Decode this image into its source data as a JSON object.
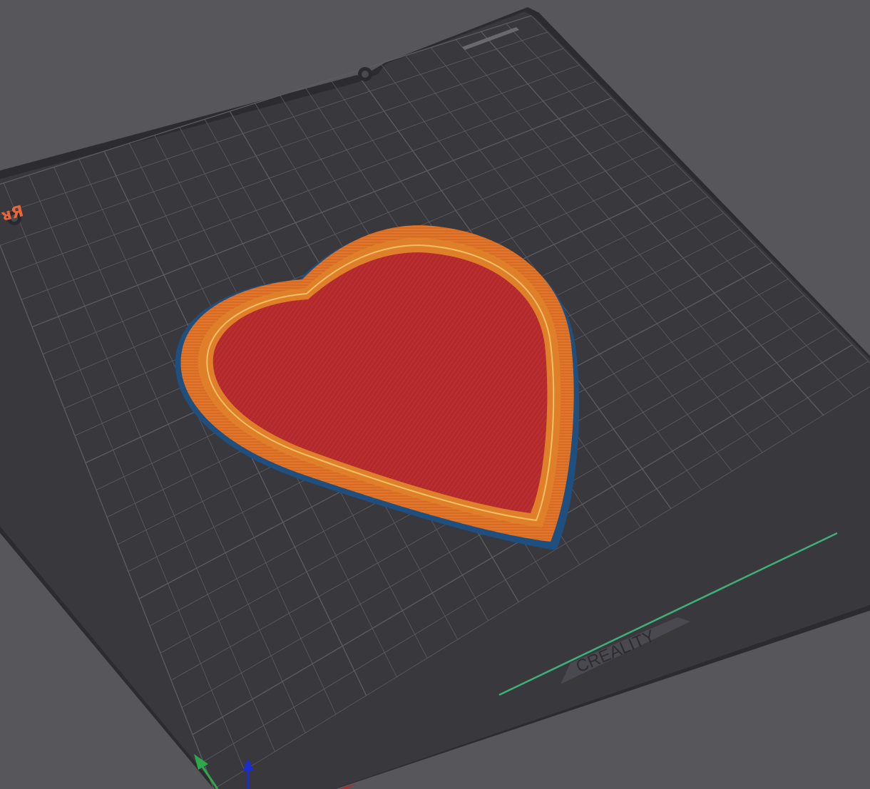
{
  "viewport": {
    "background_color": "#57565b"
  },
  "build_plate": {
    "brand_label": "CREALITY",
    "corner_logo_text": "ᴚЯ",
    "plate_color": "#39383d",
    "plate_edge_color": "#2c2b30",
    "grid_color": "#5d5c62",
    "logo_color": "#e8663a",
    "grid_divisions": 22
  },
  "toolpath_preview": {
    "object_shape": "heart",
    "colors": {
      "top_surface": "#b42a2c",
      "inner_wall": "#e07f2a",
      "outer_wall": "#d96a24",
      "highlight_wall": "#f2c063",
      "bottom_skirt": "#1f4f7f"
    }
  },
  "travel_line": {
    "color": "#3fb07a"
  },
  "axis_gizmo": {
    "x_color": "#c8202a",
    "y_color": "#2ea84a",
    "z_color": "#1a2ed0"
  }
}
